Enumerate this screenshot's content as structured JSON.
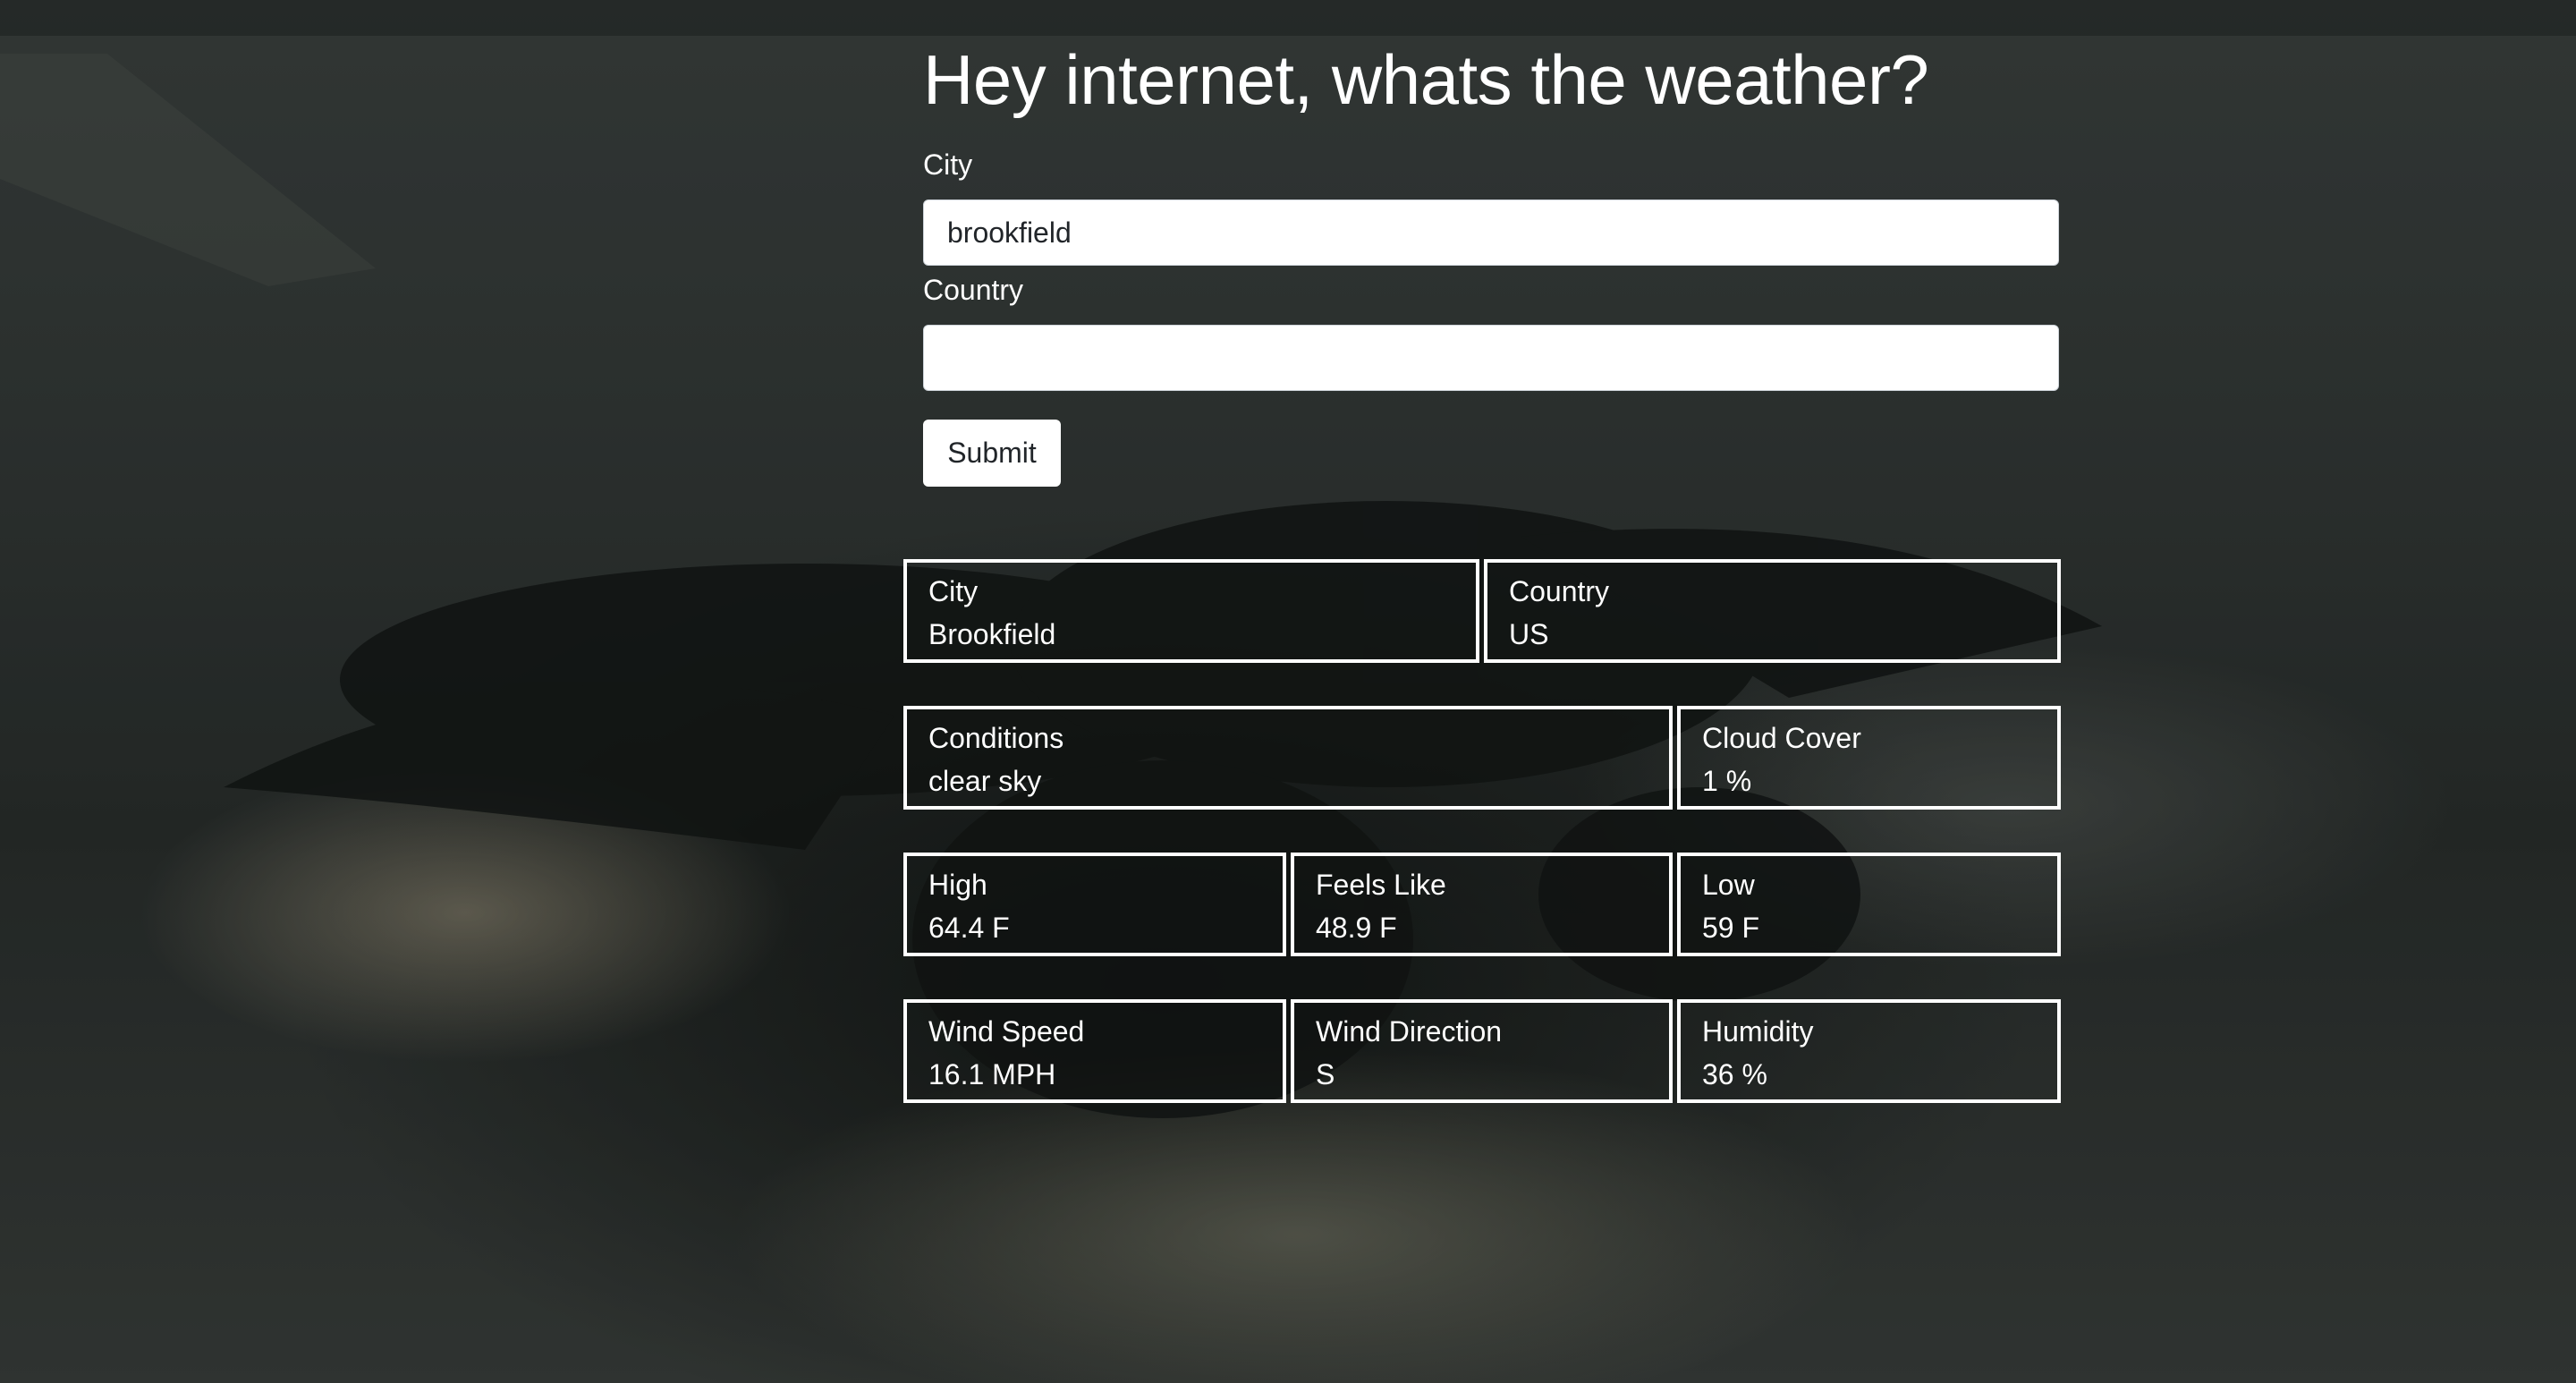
{
  "page": {
    "title": "Hey internet, whats the weather?"
  },
  "form": {
    "city_label": "City",
    "city_value": "brookfield",
    "country_label": "Country",
    "country_value": "",
    "submit_label": "Submit"
  },
  "results": {
    "city": {
      "label": "City",
      "value": "Brookfield"
    },
    "country": {
      "label": "Country",
      "value": "US"
    },
    "conditions": {
      "label": "Conditions",
      "value": "clear sky"
    },
    "cloud_cover": {
      "label": "Cloud Cover",
      "value": "1 %"
    },
    "high": {
      "label": "High",
      "value": "64.4 F"
    },
    "feels_like": {
      "label": "Feels Like",
      "value": "48.9 F"
    },
    "low": {
      "label": "Low",
      "value": "59 F"
    },
    "wind_speed": {
      "label": "Wind Speed",
      "value": "16.1 MPH"
    },
    "wind_direction": {
      "label": "Wind Direction",
      "value": "S"
    },
    "humidity": {
      "label": "Humidity",
      "value": "36 %"
    }
  },
  "colors": {
    "text": "#ffffff",
    "input_bg": "#ffffff",
    "input_text": "#212529",
    "cell_border": "#ffffff"
  }
}
